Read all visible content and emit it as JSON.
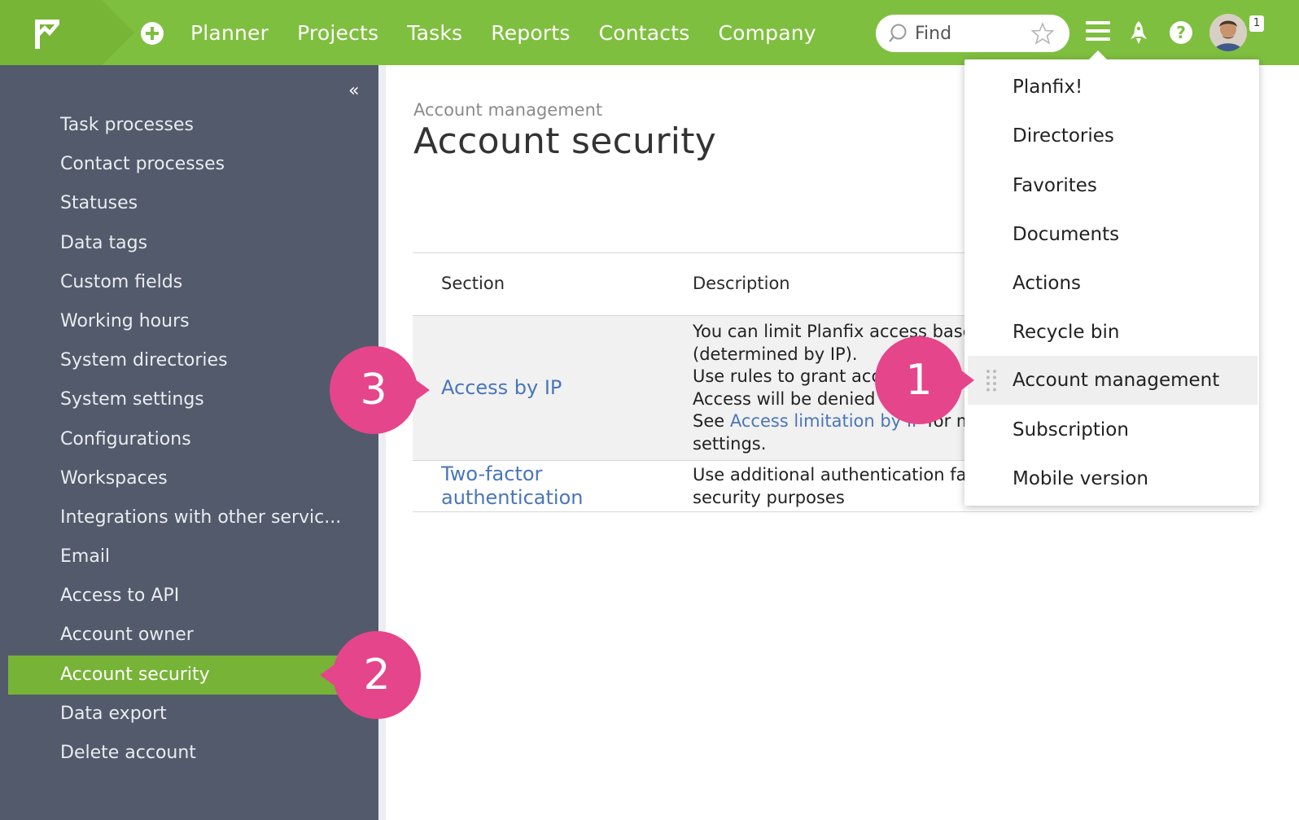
{
  "topbar": {
    "nav": [
      "Planner",
      "Projects",
      "Tasks",
      "Reports",
      "Contacts",
      "Company"
    ],
    "search_placeholder": "Find",
    "avatar_badge": "1",
    "bg_color": "#7fbf3f"
  },
  "sidebar": {
    "items": [
      {
        "label": "Task processes"
      },
      {
        "label": "Contact processes"
      },
      {
        "label": "Statuses"
      },
      {
        "label": "Data tags"
      },
      {
        "label": "Custom fields"
      },
      {
        "label": "Working hours"
      },
      {
        "label": "System directories"
      },
      {
        "label": "System settings"
      },
      {
        "label": "Configurations"
      },
      {
        "label": "Workspaces"
      },
      {
        "label": "Integrations with other servic..."
      },
      {
        "label": "Email"
      },
      {
        "label": "Access to API"
      },
      {
        "label": "Account owner"
      },
      {
        "label": "Account security"
      },
      {
        "label": "Data export"
      },
      {
        "label": "Delete account"
      }
    ],
    "active_item": "Account security",
    "bg_color": "#535a6b",
    "active_color": "#77b336"
  },
  "main": {
    "breadcrumb": "Account management",
    "title": "Account security",
    "table": {
      "headers": [
        "Section",
        "Description"
      ],
      "rows": [
        {
          "section": "Access by IP",
          "desc_lines": [
            "You can limit Planfix access base",
            "(determined by IP).",
            "Use rules to grant acce",
            "Access will be denied f"
          ],
          "desc_see": "See ",
          "desc_link": "Access limitation by IP",
          "desc_after": " for mo",
          "desc_last": "settings."
        },
        {
          "section_line1": "Two-factor",
          "section_line2": "authentication",
          "desc_line1": "Use additional authentication fac",
          "desc_line2": "security purposes"
        }
      ]
    },
    "link_color": "#4a76b8"
  },
  "dropdown": {
    "items": [
      {
        "label": "Planfix!"
      },
      {
        "label": "Directories"
      },
      {
        "label": "Favorites"
      },
      {
        "label": "Documents"
      },
      {
        "label": "Actions"
      },
      {
        "label": "Recycle bin"
      },
      {
        "label": "Account management"
      },
      {
        "label": "Subscription"
      },
      {
        "label": "Mobile version"
      }
    ],
    "highlighted": "Account management"
  },
  "callouts": {
    "one": "1",
    "two": "2",
    "three": "3",
    "color": "#e5458a"
  }
}
